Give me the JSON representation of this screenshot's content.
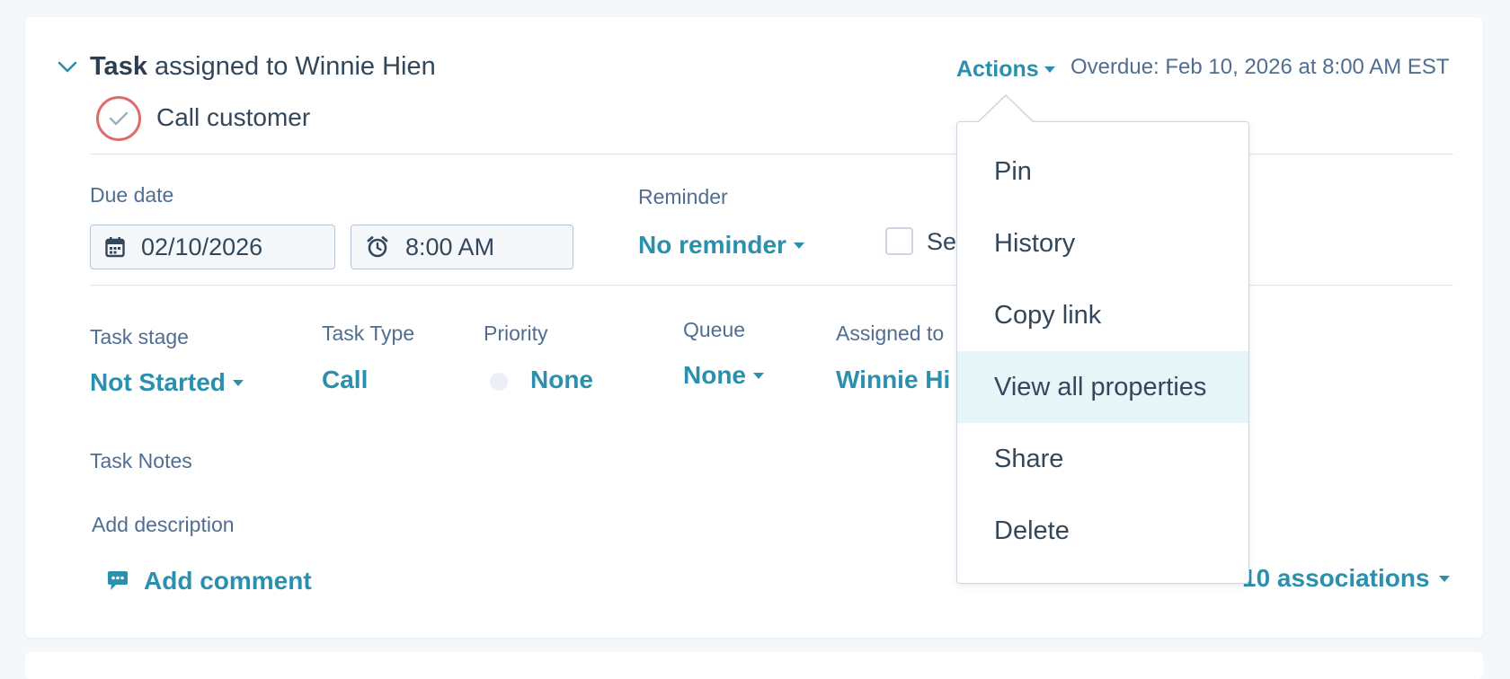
{
  "task": {
    "type_label": "Task",
    "assigned_text": "assigned to Winnie Hien",
    "name": "Call customer",
    "actions_label": "Actions",
    "overdue_text": "Overdue: Feb 10, 2026 at 8:00 AM EST"
  },
  "due": {
    "label": "Due date",
    "date": "02/10/2026",
    "time": "8:00 AM"
  },
  "reminder": {
    "label": "Reminder",
    "value": "No reminder"
  },
  "set_checkbox_text": "Se",
  "properties": {
    "stage": {
      "label": "Task stage",
      "value": "Not Started"
    },
    "type": {
      "label": "Task Type",
      "value": "Call"
    },
    "priority": {
      "label": "Priority",
      "value": "None"
    },
    "queue": {
      "label": "Queue",
      "value": "None"
    },
    "assigned": {
      "label": "Assigned to",
      "value": "Winnie Hi"
    }
  },
  "notes": {
    "label": "Task Notes",
    "placeholder": "Add description"
  },
  "footer": {
    "add_comment": "Add comment",
    "associations": "10 associations"
  },
  "menu": {
    "items": [
      "Pin",
      "History",
      "Copy link",
      "View all properties",
      "Share",
      "Delete"
    ],
    "highlighted": "View all properties"
  },
  "colors": {
    "accent": "#2b8fae",
    "overdue_ring": "#e06b6b",
    "highlight": "#e5f5f8",
    "text": "#33475b"
  }
}
